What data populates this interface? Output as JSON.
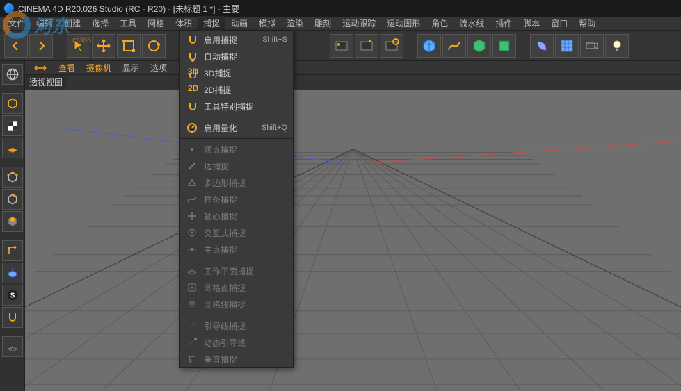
{
  "title": "CINEMA 4D R20.026 Studio (RC - R20) - [未标题 1 *] - 主要",
  "menubar": [
    "文件",
    "编辑",
    "创建",
    "选择",
    "工具",
    "网格",
    "体积",
    "捕捉",
    "动画",
    "模拟",
    "渲染",
    "雕刻",
    "运动跟踪",
    "运动图形",
    "角色",
    "流水线",
    "插件",
    "脚本",
    "窗口",
    "帮助"
  ],
  "open_menu_index": 7,
  "dropdown": {
    "groups": [
      [
        {
          "label": "启用捕捉",
          "shortcut": "Shift+S",
          "enabled": true,
          "icon": "snap-toggle"
        },
        {
          "label": "自动捕捉",
          "enabled": true,
          "icon": "snap-auto"
        },
        {
          "label": "3D捕捉",
          "enabled": true,
          "icon": "snap-3d"
        },
        {
          "label": "2D捕捉",
          "enabled": true,
          "icon": "snap-2d"
        },
        {
          "label": "工具特别捕捉",
          "enabled": true,
          "icon": "snap-tool"
        }
      ],
      [
        {
          "label": "启用量化",
          "shortcut": "Shift+Q",
          "enabled": true,
          "icon": "quantize"
        }
      ],
      [
        {
          "label": "顶点捕捉",
          "enabled": false,
          "icon": "snap-vertex"
        },
        {
          "label": "边捕捉",
          "enabled": false,
          "icon": "snap-edge"
        },
        {
          "label": "多边形捕捉",
          "enabled": false,
          "icon": "snap-poly"
        },
        {
          "label": "样条捕捉",
          "enabled": false,
          "icon": "snap-spline"
        },
        {
          "label": "轴心捕捉",
          "enabled": false,
          "icon": "snap-axis"
        },
        {
          "label": "交互式捕捉",
          "enabled": false,
          "icon": "snap-interactive"
        },
        {
          "label": "中点捕捉",
          "enabled": false,
          "icon": "snap-midpoint"
        }
      ],
      [
        {
          "label": "工作平面捕捉",
          "enabled": false,
          "icon": "snap-workplane"
        },
        {
          "label": "网格点捕捉",
          "enabled": false,
          "icon": "snap-gridpoint"
        },
        {
          "label": "网格线捕捉",
          "enabled": false,
          "icon": "snap-gridline"
        }
      ],
      [
        {
          "label": "引导线捕捉",
          "enabled": false,
          "icon": "snap-guide"
        },
        {
          "label": "动态引导线",
          "enabled": false,
          "icon": "snap-dynguide"
        },
        {
          "label": "垂直捕捉",
          "enabled": false,
          "icon": "snap-perp"
        }
      ]
    ]
  },
  "viewport": {
    "menus": [
      "查看",
      "摄像机",
      "显示",
      "选项",
      "过滤"
    ],
    "label": "透视视图"
  },
  "watermark": {
    "text": "河东",
    "sub": "cr385"
  }
}
